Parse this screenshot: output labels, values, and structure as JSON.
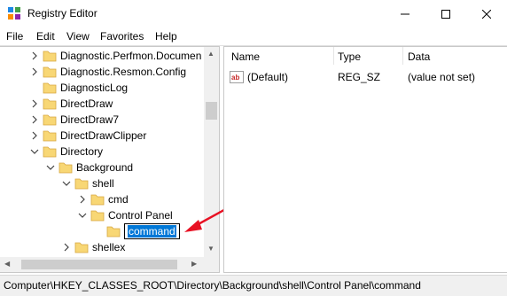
{
  "window": {
    "title": "Registry Editor",
    "icon": "registry-editor-icon"
  },
  "menu": {
    "items": [
      "File",
      "Edit",
      "View",
      "Favorites",
      "Help"
    ]
  },
  "tree": {
    "nodes": [
      {
        "label": "Diagnostic.Perfmon.Documen",
        "expander": "collapsed"
      },
      {
        "label": "Diagnostic.Resmon.Config",
        "expander": "collapsed"
      },
      {
        "label": "DiagnosticLog",
        "expander": "none"
      },
      {
        "label": "DirectDraw",
        "expander": "collapsed"
      },
      {
        "label": "DirectDraw7",
        "expander": "collapsed"
      },
      {
        "label": "DirectDrawClipper",
        "expander": "collapsed"
      },
      {
        "label": "Directory",
        "expander": "expanded"
      },
      {
        "label": "Background",
        "expander": "expanded"
      },
      {
        "label": "shell",
        "expander": "expanded"
      },
      {
        "label": "cmd",
        "expander": "collapsed"
      },
      {
        "label": "Control Panel",
        "expander": "expanded"
      },
      {
        "label": "command",
        "expander": "none",
        "editing": true
      },
      {
        "label": "shellex",
        "expander": "collapsed"
      }
    ]
  },
  "list": {
    "columns": [
      "Name",
      "Type",
      "Data"
    ],
    "rows": [
      {
        "name": "(Default)",
        "type": "REG_SZ",
        "data": "(value not set)",
        "icon": "string-value-icon"
      }
    ]
  },
  "status": {
    "path": "Computer\\HKEY_CLASSES_ROOT\\Directory\\Background\\shell\\Control Panel\\command"
  },
  "colors": {
    "selection": "#0078d7",
    "folder": "#f8d775",
    "annotation_arrow": "#e81123"
  }
}
